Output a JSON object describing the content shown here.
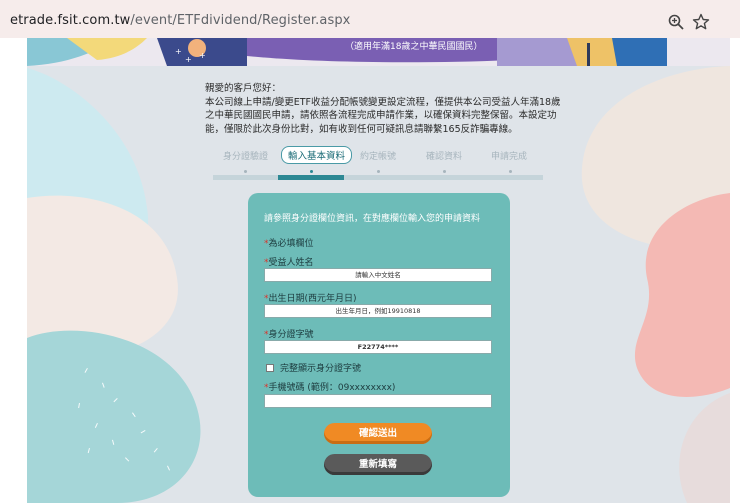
{
  "browser": {
    "url_host": "etrade.fsit.com.tw",
    "url_path": "/event/ETFdividend/Register.aspx"
  },
  "banner": {
    "note": "（適用年滿18歲之中華民國國民）"
  },
  "intro": {
    "greeting": "親愛的客戶您好：",
    "body": "本公司線上申請/變更ETF收益分配帳號變更設定流程，僅提供本公司受益人年滿18歲之中華民國國民申請，請依照各流程完成申請作業，以確保資料完整保留。本設定功能，僅限於此次身份比對，如有收到任何可疑訊息請聯繫165反詐騙專線。"
  },
  "steps": {
    "items": [
      {
        "label": "身分證驗證"
      },
      {
        "label": "輸入基本資料"
      },
      {
        "label": "約定帳號"
      },
      {
        "label": "確認資料"
      },
      {
        "label": "申請完成"
      }
    ],
    "active_index": 1
  },
  "form": {
    "instruction": "請參照身分證欄位資訊，在對應欄位輸入您的申請資料",
    "required_note": "為必填欄位",
    "name_label": "受益人姓名",
    "name_placeholder": "請輸入中文姓名",
    "dob_label": "出生日期(西元年月日)",
    "dob_placeholder": "出生年月日，例如19910818",
    "id_label": "身分證字號",
    "id_value": "F22774****",
    "show_id_label": "完整顯示身分證字號",
    "phone_label": "手機號碼 (範例：09xxxxxxxx)",
    "phone_value": "",
    "submit_label": "確認送出",
    "reset_label": "重新填寫"
  },
  "colors": {
    "card": "#6dbcb8",
    "submit": "#f08a24",
    "reset": "#5a5a5a",
    "active_step": "#2d8894"
  }
}
